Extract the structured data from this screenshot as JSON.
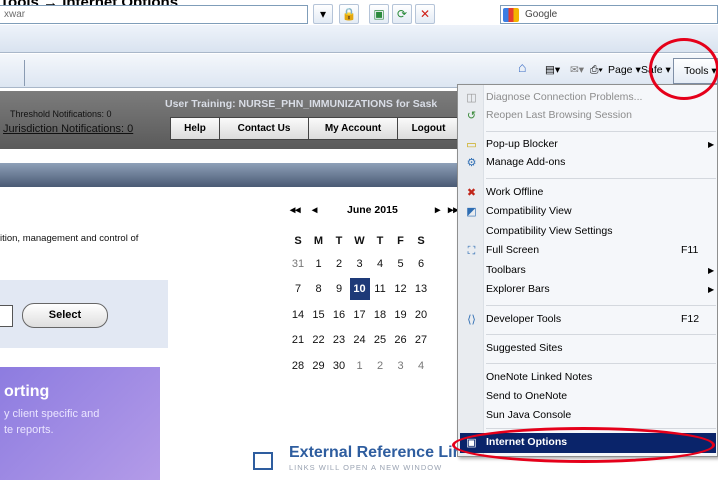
{
  "instruction": "Tools → Internet Options",
  "browser": {
    "address_value": "xwar",
    "search_placeholder": "Google",
    "commands": {
      "page": "Page",
      "safety": "Safe",
      "tools": "Tools"
    }
  },
  "app": {
    "threshold": "Threshold Notifications: 0",
    "jurisdiction": "Jurisdiction Notifications: 0",
    "user_training": "User Training: NURSE_PHN_IMMUNIZATIONS for Sask",
    "buttons": {
      "help": "Help",
      "contact": "Contact Us",
      "account": "My Account",
      "logout": "Logout"
    }
  },
  "content": {
    "description": "ition, management and control of",
    "select_label": "Select",
    "report_title": "orting",
    "report_line1": "y client specific and",
    "report_line2": "te reports."
  },
  "calendar": {
    "month": "June 2015",
    "prev_year": "◂◂",
    "prev_month": "◂",
    "next_month": "▸",
    "next_year": "▸▸",
    "days": [
      "S",
      "M",
      "T",
      "W",
      "T",
      "F",
      "S"
    ],
    "weeks": [
      [
        "31",
        "1",
        "2",
        "3",
        "4",
        "5",
        "6"
      ],
      [
        "7",
        "8",
        "9",
        "10",
        "11",
        "12",
        "13"
      ],
      [
        "14",
        "15",
        "16",
        "17",
        "18",
        "19",
        "20"
      ],
      [
        "21",
        "22",
        "23",
        "24",
        "25",
        "26",
        "27"
      ],
      [
        "28",
        "29",
        "30",
        "1",
        "2",
        "3",
        "4"
      ]
    ],
    "today": "10"
  },
  "external": {
    "title": "External Reference Links",
    "subtitle": "LINKS WILL OPEN A NEW WINDOW"
  },
  "tools_menu": {
    "diagnose": "Diagnose Connection Problems...",
    "reopen": "Reopen Last Browsing Session",
    "popup": "Pop-up Blocker",
    "addons": "Manage Add-ons",
    "offline": "Work Offline",
    "compat": "Compatibility View",
    "compat_settings": "Compatibility View Settings",
    "fullscreen": "Full Screen",
    "fullscreen_key": "F11",
    "toolbars": "Toolbars",
    "explorer_bars": "Explorer Bars",
    "devtools": "Developer Tools",
    "devtools_key": "F12",
    "suggested": "Suggested Sites",
    "onenote_linked": "OneNote Linked Notes",
    "send_onenote": "Send to OneNote",
    "java": "Sun Java Console",
    "internet_options": "Internet Options"
  },
  "colors": {
    "highlight": "#0a246a",
    "annotation": "#e5001a",
    "header": "#5a5a5a"
  }
}
